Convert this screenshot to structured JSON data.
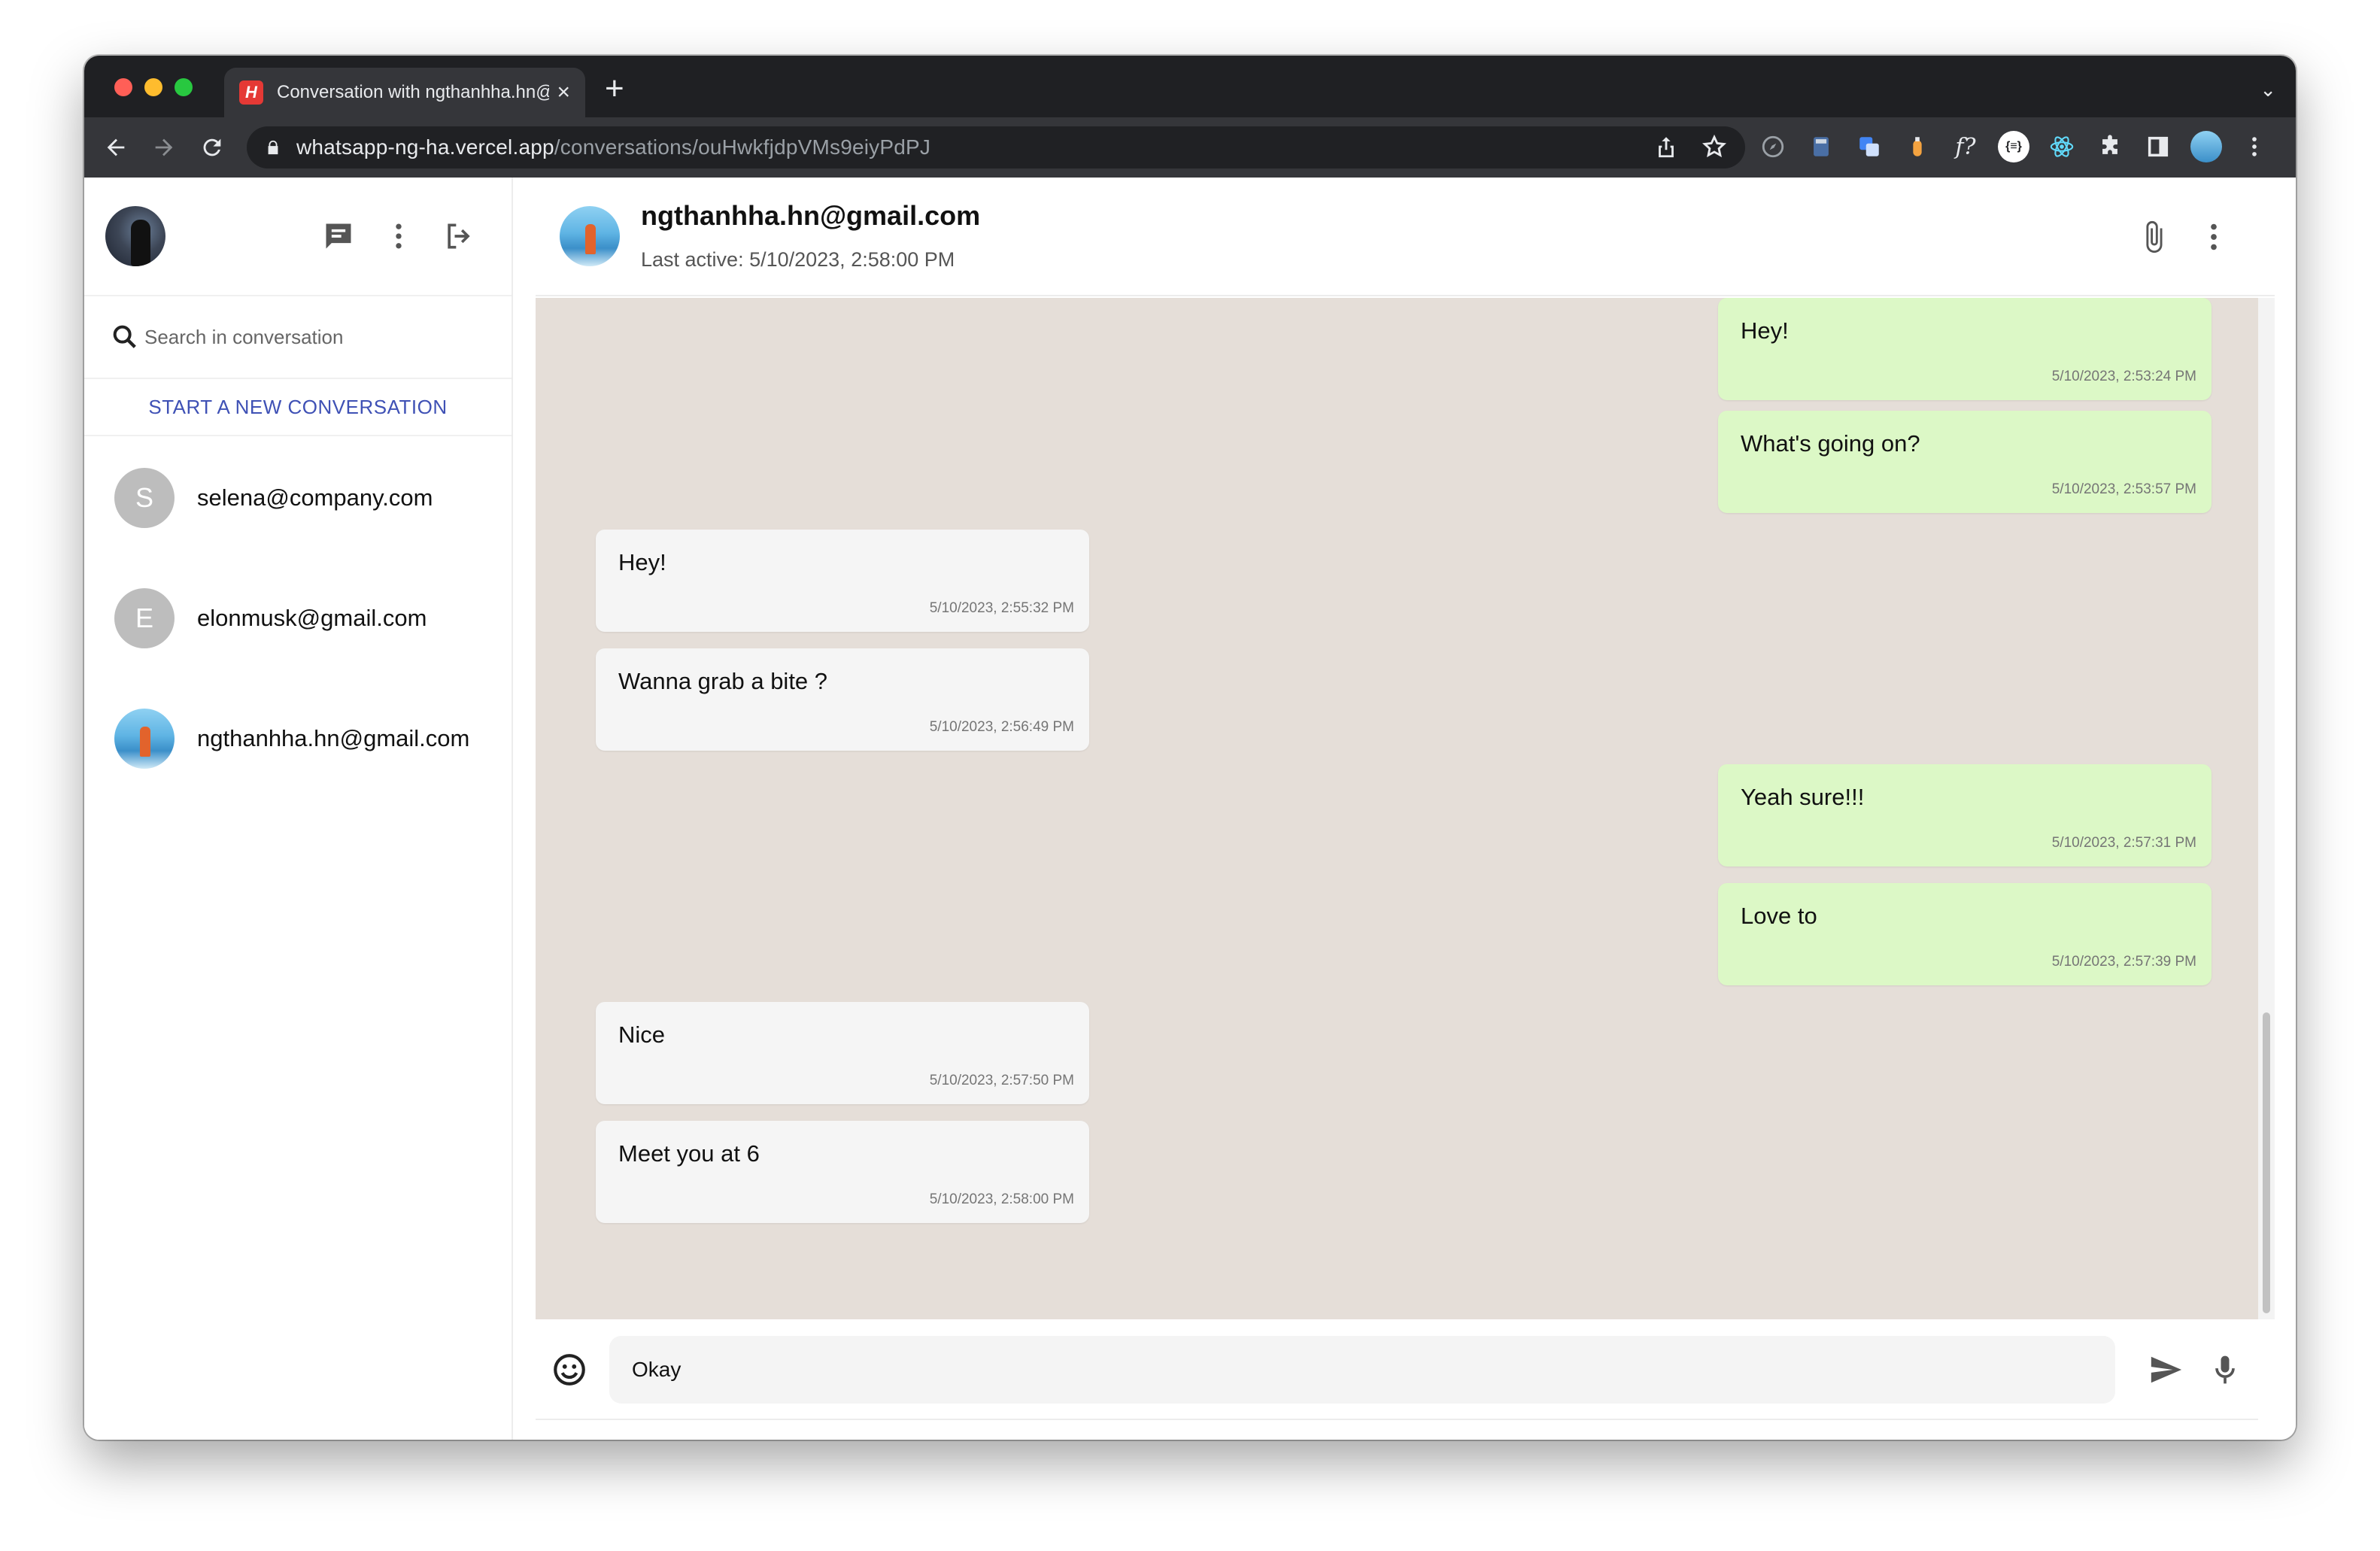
{
  "browser": {
    "tab_title": "Conversation with ngthanhha.hn@gmail.com",
    "tab_favicon_glyph": "H",
    "url_domain": "whatsapp-ng-ha.vercel.app",
    "url_path": "/conversations/ouHwkfjdpVMs9eiyPdPJ",
    "extension_icons": [
      "share-icon",
      "bookmark-star-icon",
      "compass-icon",
      "calculator-icon",
      "translate-icon",
      "bottle-icon",
      "function-icon",
      "json-icon",
      "react-icon",
      "puzzle-icon",
      "sidepanel-icon",
      "profile-icon",
      "menu-dots-icon"
    ]
  },
  "sidebar": {
    "search_placeholder": "Search in conversation",
    "new_conversation_label": "START A NEW CONVERSATION",
    "conversations": [
      {
        "initial": "S",
        "email": "selena@company.com",
        "has_photo": false
      },
      {
        "initial": "E",
        "email": "elonmusk@gmail.com",
        "has_photo": false
      },
      {
        "initial": "",
        "email": "ngthanhha.hn@gmail.com",
        "has_photo": true
      }
    ]
  },
  "chat": {
    "title": "ngthanhha.hn@gmail.com",
    "last_active": "Last active: 5/10/2023, 2:58:00 PM",
    "messages": [
      {
        "direction": "sent",
        "text": "Hey!",
        "time": "5/10/2023, 2:53:24 PM"
      },
      {
        "direction": "sent",
        "text": "What's going on?",
        "time": "5/10/2023, 2:53:57 PM"
      },
      {
        "direction": "recv",
        "text": "Hey!",
        "time": "5/10/2023, 2:55:32 PM"
      },
      {
        "direction": "recv",
        "text": "Wanna grab a bite ?",
        "time": "5/10/2023, 2:56:49 PM"
      },
      {
        "direction": "sent",
        "text": "Yeah sure!!!",
        "time": "5/10/2023, 2:57:31 PM"
      },
      {
        "direction": "sent",
        "text": "Love to",
        "time": "5/10/2023, 2:57:39 PM"
      },
      {
        "direction": "recv",
        "text": "Nice",
        "time": "5/10/2023, 2:57:50 PM"
      },
      {
        "direction": "recv",
        "text": "Meet you at 6",
        "time": "5/10/2023, 2:58:00 PM"
      }
    ],
    "composer_value": "Okay"
  },
  "colors": {
    "sent_bubble": "#dcf8c6",
    "recv_bubble": "#f5f5f5",
    "chat_background": "#e5ded8",
    "accent": "#3f51b5"
  }
}
